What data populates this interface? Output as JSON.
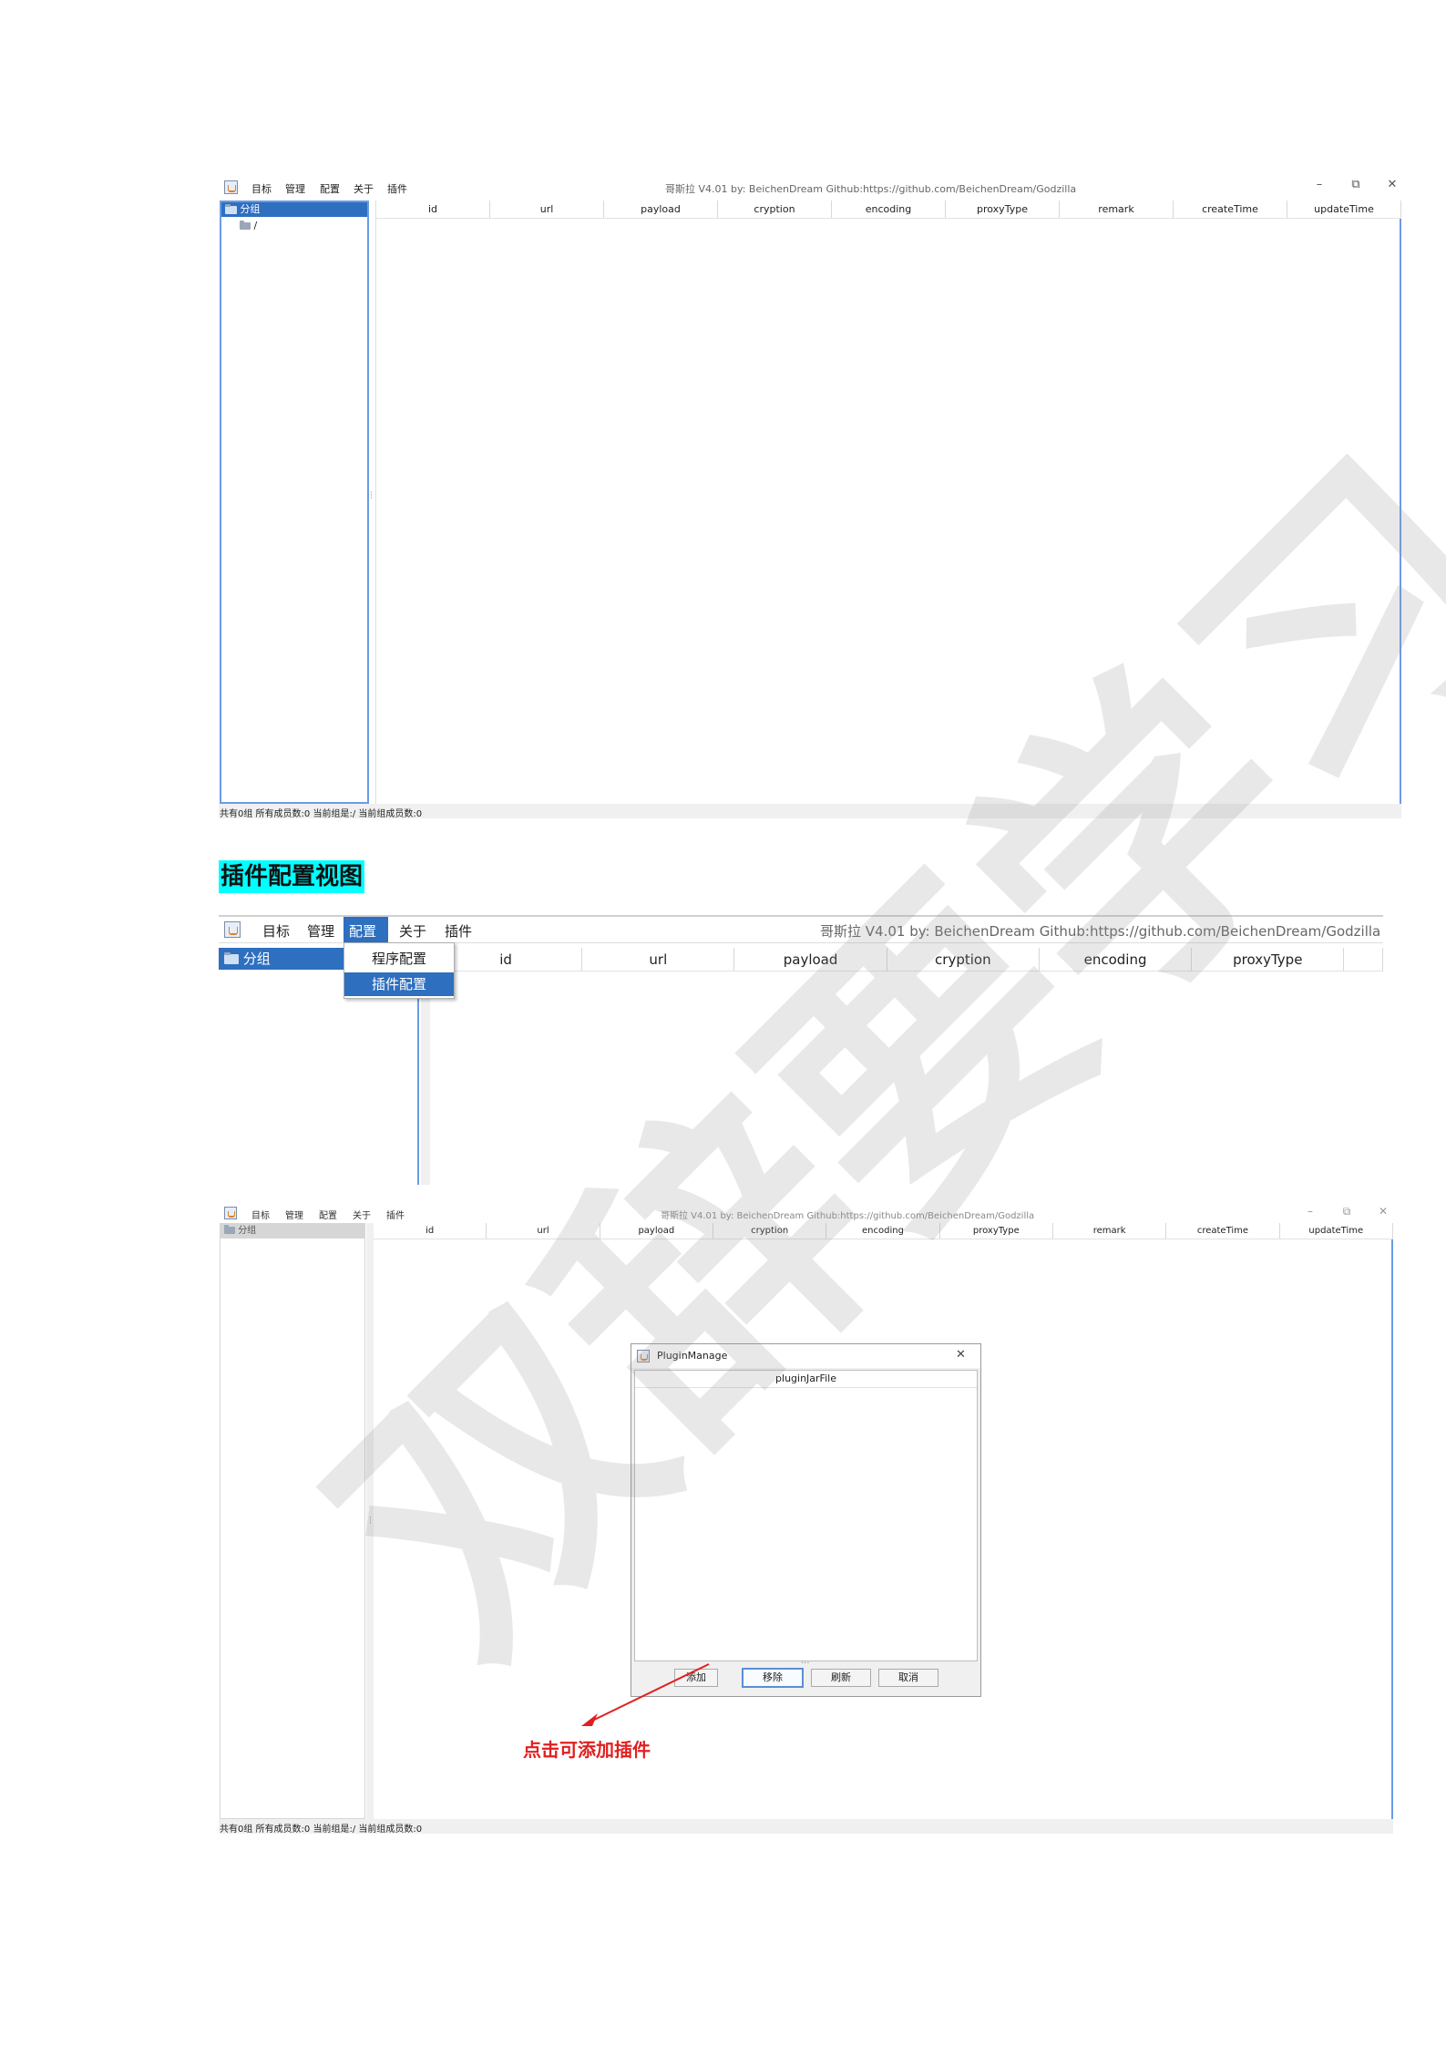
{
  "shared": {
    "menu": [
      "目标",
      "管理",
      "配置",
      "关于",
      "插件"
    ],
    "window_title": "哥斯拉   V4.01 by: BeichenDream Github:https://github.com/BeichenDream/Godzilla",
    "columns_full": [
      "id",
      "url",
      "payload",
      "cryption",
      "encoding",
      "proxyType",
      "remark",
      "createTime",
      "updateTime"
    ],
    "tree_root": "分组",
    "tree_child": "/",
    "status": "共有0组 所有成员数:0 当前组是:/ 当前组成员数:0",
    "controls": {
      "minimize": "–",
      "restore": "⧉",
      "close": "✕"
    }
  },
  "section_heading": "插件配置视图",
  "window2": {
    "title": "哥斯拉   V4.01 by: BeichenDream Github:https://github.com/BeichenDream/Godzilla",
    "columns": [
      "id",
      "url",
      "payload",
      "cryption",
      "encoding",
      "proxyType"
    ],
    "dropdown": [
      "程序配置",
      "插件配置"
    ],
    "active_menu": "配置"
  },
  "plugin_dialog": {
    "title": "PluginManage",
    "column": "pluginJarFile",
    "buttons": {
      "add": "添加",
      "remove": "移除",
      "refresh": "刷新",
      "cancel": "取消"
    }
  },
  "annotation": "点击可添加插件",
  "watermark": "双辞要学习",
  "colors": {
    "selection": "#2e6fc0",
    "highlight": "#00ffff",
    "annotation_red": "#e02020",
    "border_blue": "#6b9be6"
  },
  "icons": [
    "java-app-icon",
    "folder-open-icon",
    "folder-icon",
    "close-icon"
  ]
}
